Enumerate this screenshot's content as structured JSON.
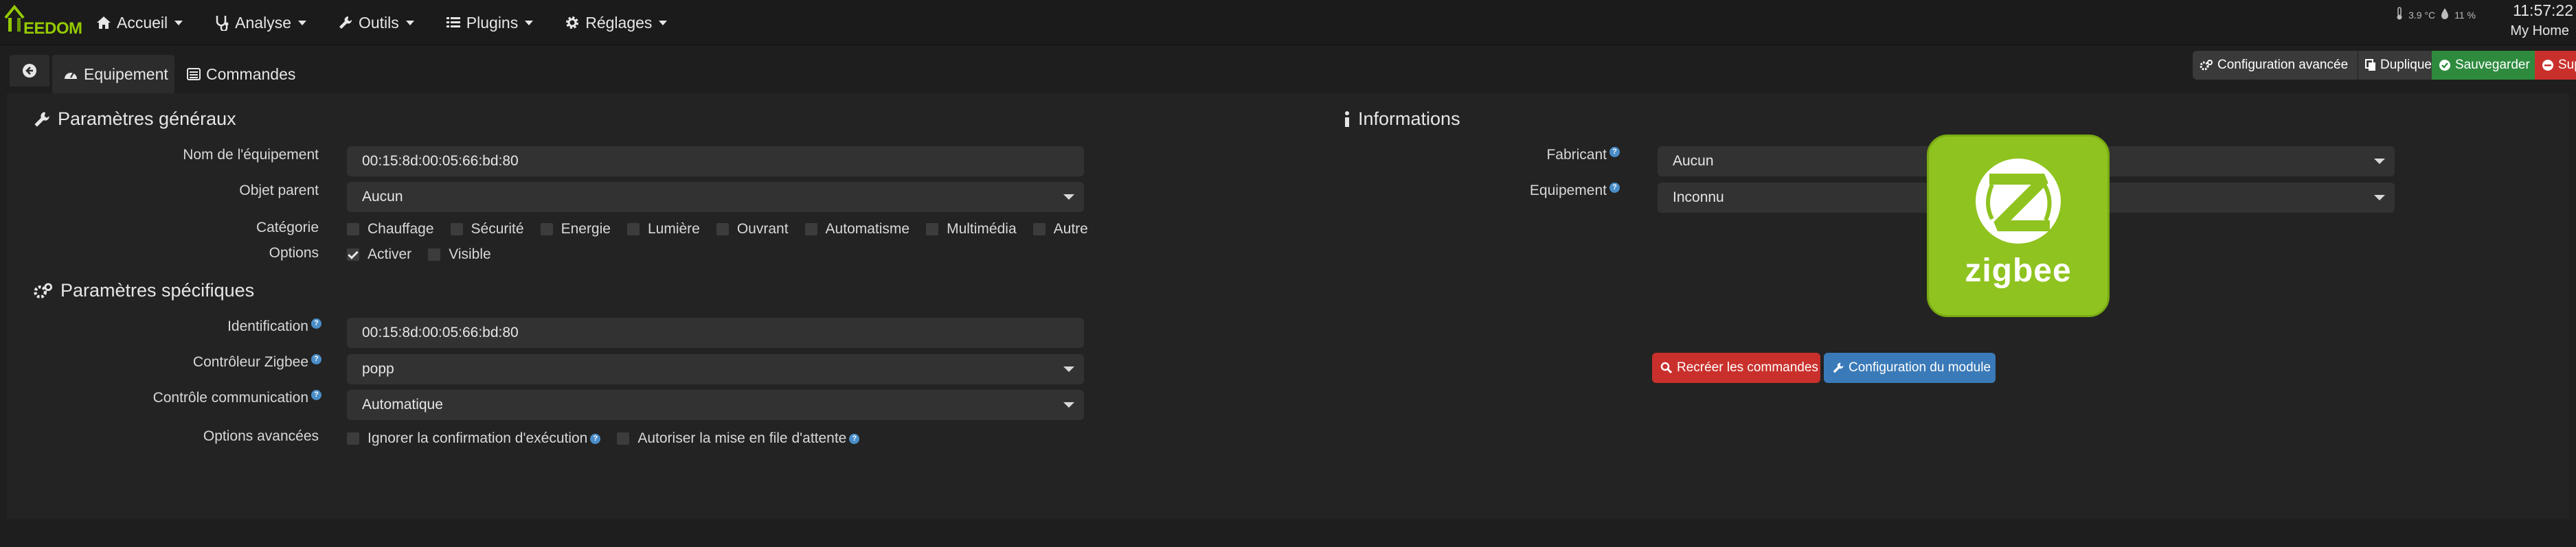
{
  "app": {
    "logo_text": "EEDOM"
  },
  "nav": {
    "items": [
      {
        "label": "Accueil"
      },
      {
        "label": "Analyse"
      },
      {
        "label": "Outils"
      },
      {
        "label": "Plugins"
      },
      {
        "label": "Réglages"
      }
    ],
    "weather": {
      "temperature": "3.9 °C",
      "humidity": "11 %"
    },
    "clock": "11:57:22",
    "home_label": "My Home"
  },
  "tabs": [
    {
      "label": "Equipement"
    },
    {
      "label": "Commandes"
    }
  ],
  "actions": {
    "advanced_config": "Configuration avancée",
    "duplicate": "Dupliquer",
    "save": "Sauvegarder",
    "delete": "Supprimer"
  },
  "general": {
    "title": "Paramètres généraux",
    "name_label": "Nom de l'équipement",
    "name_value": "00:15:8d:00:05:66:bd:80",
    "parent_label": "Objet parent",
    "parent_value": "Aucun",
    "category_label": "Catégorie",
    "categories": [
      {
        "label": "Chauffage",
        "checked": false
      },
      {
        "label": "Sécurité",
        "checked": false
      },
      {
        "label": "Energie",
        "checked": false
      },
      {
        "label": "Lumière",
        "checked": false
      },
      {
        "label": "Ouvrant",
        "checked": false
      },
      {
        "label": "Automatisme",
        "checked": false
      },
      {
        "label": "Multimédia",
        "checked": false
      },
      {
        "label": "Autre",
        "checked": false
      }
    ],
    "options_label": "Options",
    "options": [
      {
        "label": "Activer",
        "checked": true
      },
      {
        "label": "Visible",
        "checked": false
      }
    ]
  },
  "specific": {
    "title": "Paramètres spécifiques",
    "id_label": "Identification",
    "id_value": "00:15:8d:00:05:66:bd:80",
    "controller_label": "Contrôleur Zigbee",
    "controller_value": "popp",
    "comm_label": "Contrôle communication",
    "comm_value": "Automatique",
    "advanced_label": "Options avancées",
    "advanced_options": [
      {
        "label": "Ignorer la confirmation d'exécution",
        "checked": false
      },
      {
        "label": "Autoriser la mise en file d'attente",
        "checked": false
      }
    ]
  },
  "info": {
    "title": "Informations",
    "maker_label": "Fabricant",
    "maker_value": "Aucun",
    "equipment_label": "Equipement",
    "equipment_value": "Inconnu",
    "image_word": "zigbee",
    "recreate_btn": "Recréer les commandes",
    "module_cfg_btn": "Configuration du module"
  },
  "colors": {
    "accent_green": "#94ca02",
    "save_green": "#2e8b3e",
    "danger_red": "#c9302c",
    "primary_blue": "#3a7ab8",
    "zigbee_green": "#8fc31f"
  }
}
